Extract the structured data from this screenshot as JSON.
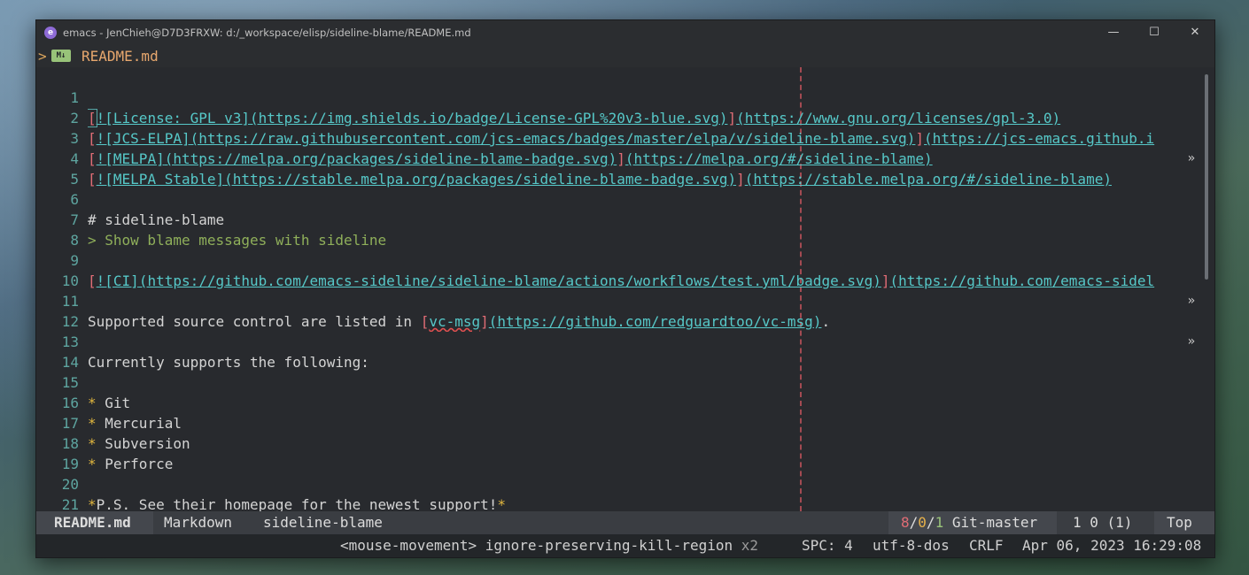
{
  "window": {
    "title": "emacs - JenChieh@D7D3FRXW: d:/_workspace/elisp/sideline-blame/README.md",
    "controls": {
      "minimize": "—",
      "maximize": "☐",
      "close": "✕"
    }
  },
  "header": {
    "arrow": ">",
    "icon": "markdown-icon",
    "file_name": "README.md"
  },
  "lines": [
    {
      "n": "1"
    },
    {
      "n": "2"
    },
    {
      "n": "3"
    },
    {
      "n": "4"
    },
    {
      "n": "5"
    },
    {
      "n": "6"
    },
    {
      "n": "7"
    },
    {
      "n": "8"
    },
    {
      "n": "9"
    },
    {
      "n": "10"
    },
    {
      "n": "11"
    },
    {
      "n": "12"
    },
    {
      "n": "13"
    },
    {
      "n": "14"
    },
    {
      "n": "15"
    },
    {
      "n": "16"
    },
    {
      "n": "17"
    },
    {
      "n": "18"
    },
    {
      "n": "19"
    },
    {
      "n": "20"
    },
    {
      "n": "21"
    }
  ],
  "content": {
    "l1": {
      "b1": "[",
      "alt": "![License: GPL v3]",
      "url": "(https://img.shields.io/badge/License-GPL%20v3-blue.svg)",
      "b2": "]",
      "link": "(https://www.gnu.org/licenses/gpl-3.0)"
    },
    "l2": {
      "b1": "[",
      "alt": "![JCS-ELPA]",
      "url": "(https://raw.githubusercontent.com/jcs-emacs/badges/master/elpa/v/sideline-blame.svg)",
      "b2": "]",
      "link": "(https://jcs-emacs.github.i"
    },
    "l3": {
      "b1": "[",
      "alt": "![MELPA]",
      "url": "(https://melpa.org/packages/sideline-blame-badge.svg)",
      "b2": "]",
      "link": "(https://melpa.org/#/sideline-blame)"
    },
    "l4": {
      "b1": "[",
      "alt": "![MELPA Stable]",
      "url": "(https://stable.melpa.org/packages/sideline-blame-badge.svg)",
      "b2": "]",
      "link": "(https://stable.melpa.org/#/sideline-blame)"
    },
    "l6": "# sideline-blame",
    "l7": "> Show blame messages with sideline",
    "l9": {
      "b1": "[",
      "alt": "![CI]",
      "url": "(https://github.com/emacs-sideline/sideline-blame/actions/workflows/test.yml/badge.svg)",
      "b2": "]",
      "link": "(https://github.com/emacs-sidel"
    },
    "l11": {
      "pre": "Supported source control are listed in ",
      "b1": "[",
      "name": "vc-msg",
      "b2": "]",
      "link": "(https://github.com/redguardtoo/vc-msg)",
      "post": "."
    },
    "l13": "Currently supports the following:",
    "l15": {
      "bullet": "*",
      "text": " Git"
    },
    "l16": {
      "bullet": "*",
      "text": " Mercurial"
    },
    "l17": {
      "bullet": "*",
      "text": " Subversion"
    },
    "l18": {
      "bullet": "*",
      "text": " Perforce"
    },
    "l20": {
      "s1": "*",
      "text": "P.S. See their homepage for the newest support!",
      "s2": "*"
    },
    "trunc_marker": "»"
  },
  "modeline": {
    "file": "README.md",
    "mode": "Markdown",
    "project": "sideline-blame",
    "git_a": "8",
    "git_sep1": "/",
    "git_b": "0",
    "git_sep2": "/",
    "git_c": "1",
    "git_branch": " Git-master",
    "position": "1 0 (1)",
    "scroll": "Top"
  },
  "echo": {
    "event": "<mouse-movement> ignore-preserving-kill-region",
    "count": " x2",
    "spc": "SPC: 4",
    "encoding": "utf-8-dos",
    "eol": "CRLF",
    "datetime": "Apr 06, 2023 16:29:08"
  },
  "colors": {
    "link": "#56c8c8",
    "bracket": "#e06c75",
    "quote": "#8faf5a",
    "bullet": "#e2b73f",
    "line_number": "#5ea5a0"
  }
}
